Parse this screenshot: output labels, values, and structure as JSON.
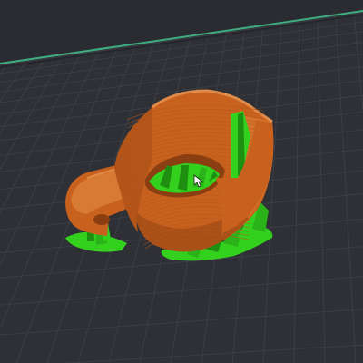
{
  "viewport": {
    "background_color": "#2c2e33",
    "bed_color": "#2e3036",
    "grid_color": "#3d4048",
    "bed_edge_color": "#3fae7e"
  },
  "model": {
    "preview_mode": "sliced-layer-preview",
    "colors": {
      "outer_wall": "#c8611e",
      "wall_light": "#d77a33",
      "wall_shadow": "#8a3e12",
      "top_edge": "#e08b4a",
      "support": "#33d11d",
      "support_dark": "#1f8f12"
    }
  },
  "cursor": {
    "icon": "mouse-pointer-icon"
  }
}
